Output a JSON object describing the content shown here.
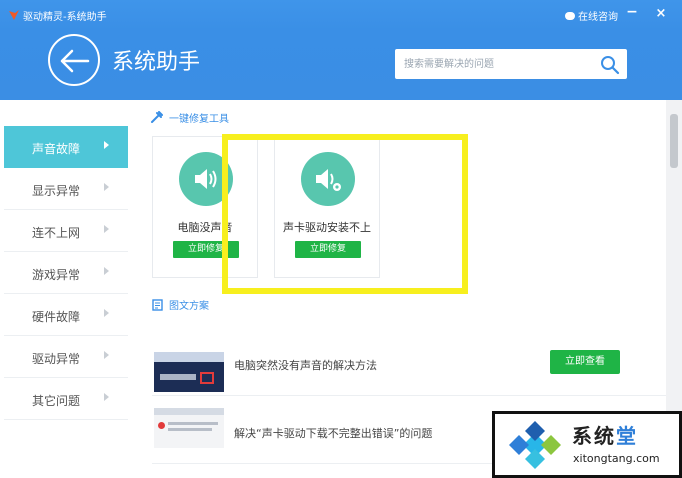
{
  "titlebar": {
    "app_title": "驱动精灵-系统助手",
    "help_label": "在线咨询",
    "minimize_label": "−",
    "close_label": "×"
  },
  "header": {
    "page_title": "系统助手",
    "search_placeholder": "搜索需要解决的问题"
  },
  "sidebar": {
    "items": [
      {
        "label": "声音故障",
        "active": true
      },
      {
        "label": "显示异常",
        "active": false
      },
      {
        "label": "连不上网",
        "active": false
      },
      {
        "label": "游戏异常",
        "active": false
      },
      {
        "label": "硬件故障",
        "active": false
      },
      {
        "label": "驱动异常",
        "active": false
      },
      {
        "label": "其它问题",
        "active": false
      }
    ]
  },
  "repair_tools": {
    "section_title": "一键修复工具",
    "cards": [
      {
        "name": "电脑没声音",
        "button": "立即修复",
        "icon": "speaker-icon"
      },
      {
        "name": "声卡驱动安装不上",
        "button": "立即修复",
        "icon": "speaker-gear-icon"
      }
    ]
  },
  "articles": {
    "section_title": "图文方案",
    "items": [
      {
        "title": "电脑突然没有声音的解决方法",
        "button": "立即查看"
      },
      {
        "title": "解决“声卡驱动下载不完整出错误”的问题",
        "button": ""
      }
    ]
  },
  "watermark": {
    "brand_main": "系统",
    "brand_accent": "堂",
    "url": "xitongtang.com"
  },
  "colors": {
    "primary_blue": "#3a8fe6",
    "active_teal": "#4ec6d8",
    "icon_green": "#58c6ae",
    "button_green": "#1fb446",
    "highlight_yellow": "#f7ef1e"
  }
}
